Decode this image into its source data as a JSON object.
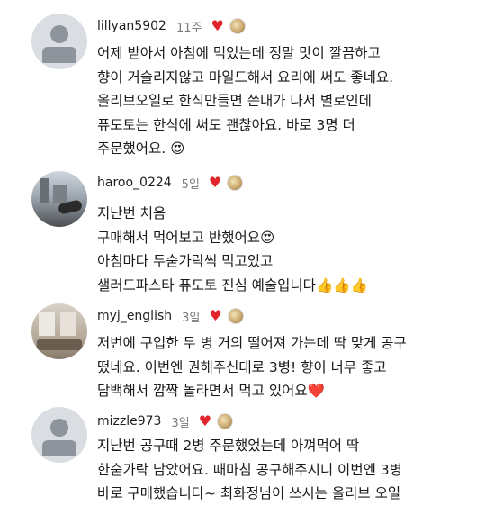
{
  "comments": [
    {
      "username": "lillyan5902",
      "time": "11주",
      "text": "어제 받아서 아침에 먹었는데 정말 맛이 깔끔하고\n향이 거슬리지않고 마일드해서 요리에 써도 좋네요.\n올리브오일로 한식만들면 쓴내가 나서 별로인데\n퓨도토는 한식에 써도 괜찮아요. 바로 3명 더\n주문했어요. 😍"
    },
    {
      "username": "haroo_0224",
      "time": "5일",
      "text": "지난번 처음\n구매해서 먹어보고 반했어요😍\n아침마다 두숟가락씩 먹고있고\n샐러드파스타 퓨도토 진심 예술입니다👍👍👍"
    },
    {
      "username": "myj_english",
      "time": "3일",
      "text": "저번에 구입한 두 병 거의 떨어져 가는데 딱 맞게 공구\n떴네요. 이번엔 권해주신대로 3병! 향이 너무 좋고\n담백해서 깜짝 놀라면서 먹고 있어요❤️"
    },
    {
      "username": "mizzle973",
      "time": "3일",
      "text": "지난번 공구때 2병 주문했었는데 아껴먹어 딱\n한숟가락 남았어요. 때마침 공구해주시니 이번엔 3병\n바로 구매했습니다~ 최화정님이 쓰시는 올리브 오일"
    }
  ],
  "icons": {
    "like": "heart-icon",
    "liked_by_author": "author-avatar-icon"
  },
  "colors": {
    "heart": "#e0242a",
    "username": "#1f1f1f",
    "time": "#7a7a7a"
  }
}
